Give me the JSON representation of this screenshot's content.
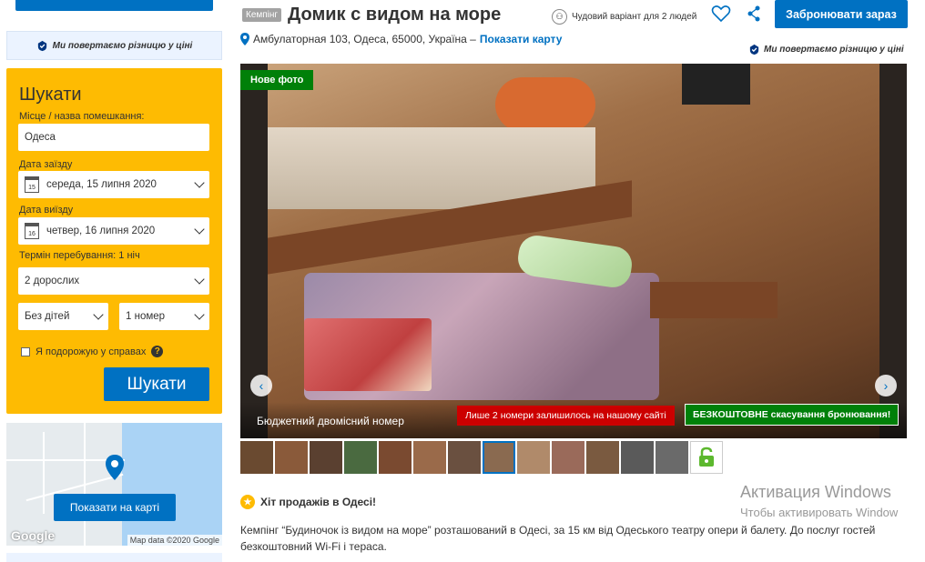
{
  "sidebar": {
    "price_match": "Ми повертаємо різницю у ціні",
    "search": {
      "title": "Шукати",
      "place_label": "Місце / назва помешкання:",
      "place_value": "Одеса",
      "checkin_label": "Дата заїзду",
      "checkin_value": "середа, 15 липня 2020",
      "checkin_day": "15",
      "checkout_label": "Дата виїзду",
      "checkout_value": "четвер, 16 липня 2020",
      "checkout_day": "16",
      "duration": "Термін перебування: 1 ніч",
      "adults": "2 дорослих",
      "children": "Без дітей",
      "rooms": "1 номер",
      "business": "Я подорожую у справах",
      "search_button": "Шукати"
    },
    "map": {
      "show_map_button": "Показати на карті",
      "google": "Google",
      "credit": "Map data ©2020 Google"
    }
  },
  "hotel": {
    "type_badge": "Кемпінг",
    "name": "Домик с видом на море",
    "family_note": "Чудовий варіант для 2 людей",
    "book_button": "Забронювати зараз",
    "address": "Амбулаторная 103, Одеса, 65000, Україна –",
    "show_map": "Показати карту",
    "price_match": "Ми повертаємо різницю у ціні"
  },
  "gallery": {
    "new_photo": "Нове фото",
    "room_name": "Бюджетний двомісний номер",
    "rooms_left": "Лише 2 номери залишилось на нашому сайті",
    "free_cancel": "БЕЗКОШТОВНЕ скасування бронювання!",
    "prev": "‹",
    "next": "›"
  },
  "bestseller": "Хіт продажів в Одесі!",
  "description": "Кемпінг “Будиночок із видом на море” розташований в Одесі, за 15 км від Одеського театру опери й балету. До послуг гостей безкоштовний Wi-Fi і тераса.",
  "watermark": {
    "line1": "Активация Windows",
    "line2": "Чтобы активировать Window"
  },
  "colors": {
    "brand_blue": "#0071c2",
    "search_yellow": "#febb02",
    "green": "#008009",
    "red": "#cc0000"
  }
}
